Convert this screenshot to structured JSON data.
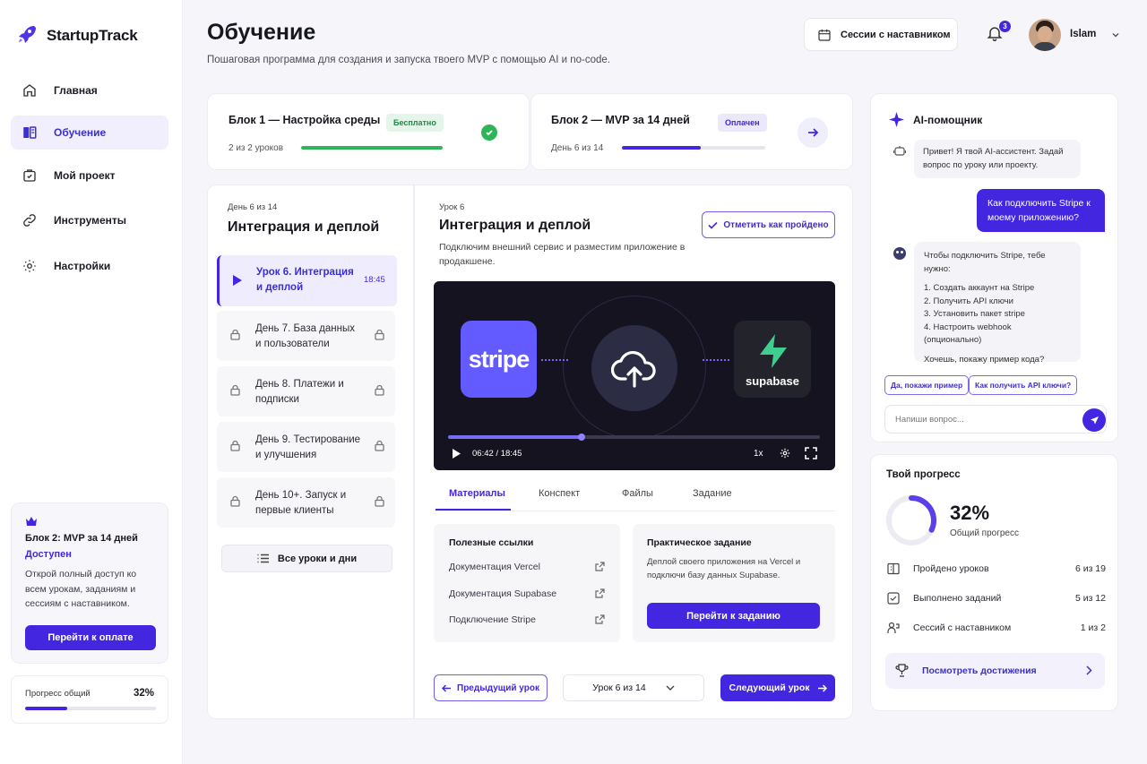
{
  "app": {
    "name": "StartupTrack"
  },
  "sidebar": {
    "items": [
      {
        "label": "Главная",
        "icon": "home-icon"
      },
      {
        "label": "Обучение",
        "icon": "book-icon",
        "active": true
      },
      {
        "label": "Мой проект",
        "icon": "project-icon"
      },
      {
        "label": "Инструменты",
        "icon": "link-icon"
      },
      {
        "label": "Настройки",
        "icon": "gear-icon"
      }
    ],
    "upsell": {
      "title": "Блок 2: MVP за 14 дней",
      "status": "Доступен",
      "text": "Открой полный доступ ко всем урокам, заданиям и сессиям с наставником.",
      "button": "Перейти к оплате"
    },
    "overall": {
      "label": "Прогресс общий",
      "value": "32%",
      "fraction": 0.32
    }
  },
  "header": {
    "title": "Обучение",
    "subtitle": "Пошаговая программа для создания и запуска твоего MVP с помощью AI и no-code.",
    "sessions_button": "Сессии с наставником",
    "notifications_count": "3",
    "user_name": "Islam"
  },
  "blocks": [
    {
      "title": "Блок 1 — Настройка среды",
      "badge": "Бесплатно",
      "progress_text": "2 из 2 уроков",
      "fraction": 1.0,
      "status": "done"
    },
    {
      "title": "Блок 2 — MVP за 14 дней",
      "badge": "Оплачен",
      "progress_text": "День 6 из 14",
      "fraction": 0.55,
      "status": "next"
    }
  ],
  "lesson_list": {
    "day_label": "День 6 из 14",
    "title": "Интеграция и деплой",
    "current": {
      "label": "Урок 6. Интеграция и деплой",
      "duration": "18:45"
    },
    "locked": [
      "День 7. База данных и пользователи",
      "День 8. Платежи и подписки",
      "День 9. Тестирование и улучшения",
      "День 10+. Запуск и первые клиенты"
    ],
    "all_button": "Все уроки и дни"
  },
  "lesson": {
    "label": "Урок 6",
    "title": "Интеграция и деплой",
    "description": "Подключим внешний сервис и разместим приложение в продакшене.",
    "mark_done": "Отметить как пройдено",
    "video": {
      "left_logo": "stripe",
      "right_logo": "supabase",
      "time": "06:42 / 18:45",
      "position_fraction": 0.36,
      "speed": "1x"
    },
    "tabs": [
      "Материалы",
      "Конспект",
      "Файлы",
      "Задание"
    ],
    "active_tab": "Материалы",
    "links_title": "Полезные ссылки",
    "links": [
      "Документация Vercel",
      "Документация Supabase",
      "Подключение Stripe"
    ],
    "task_title": "Практическое задание",
    "task_text": "Деплой своего приложения на Vercel и подключи базу данных Supabase.",
    "task_button": "Перейти к заданию",
    "prev": "Предыдущий урок",
    "selector": "Урок 6 из 14",
    "next": "Следующий урок"
  },
  "assistant": {
    "title": "AI-помощник",
    "greeting": "Привет! Я твой AI-ассистент. Задай вопрос по уроку или проекту.",
    "user_msg": "Как подключить Stripe к моему приложению?",
    "reply_intro": "Чтобы подключить Stripe, тебе нужно:",
    "steps": [
      "1. Создать аккаунт на Stripe",
      "2. Получить API ключи",
      "3. Установить пакет stripe",
      "4. Настроить webhook (опционально)"
    ],
    "reply_outro": "Хочешь, покажу пример кода?",
    "chips": [
      "Да, покажи пример",
      "Как получить API ключи?"
    ],
    "input_placeholder": "Напиши вопрос..."
  },
  "progress": {
    "title": "Твой прогресс",
    "percent": "32%",
    "fraction": 0.32,
    "label": "Общий прогресс",
    "stats": [
      {
        "label": "Пройдено уроков",
        "value": "6 из 19"
      },
      {
        "label": "Выполнено заданий",
        "value": "5 из 12"
      },
      {
        "label": "Сессий с наставником",
        "value": "1 из 2"
      }
    ],
    "achievements": "Посмотреть достижения"
  },
  "colors": {
    "accent": "#4327e0",
    "green": "#2fb45a",
    "stripe": "#635bff",
    "supabase": "#3ecf8e"
  }
}
